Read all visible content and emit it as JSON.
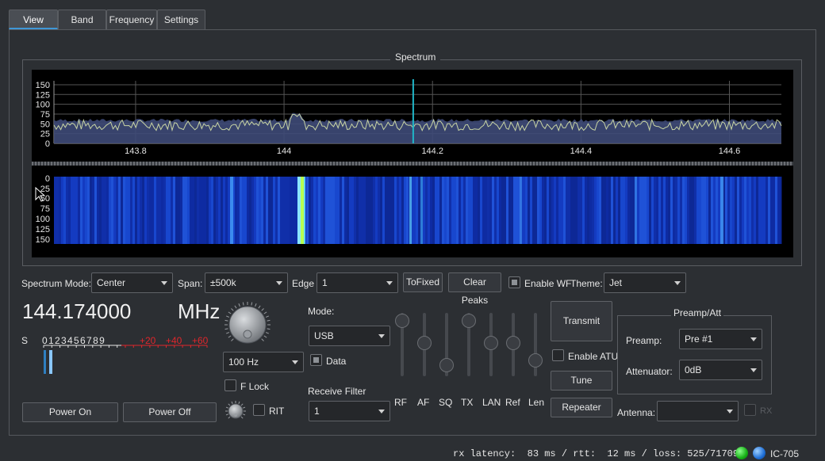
{
  "tabs": [
    {
      "label": "View"
    },
    {
      "label": "Band"
    },
    {
      "label": "Frequency"
    },
    {
      "label": "Settings"
    }
  ],
  "spectrum": {
    "title": "Spectrum",
    "y_ticks": [
      "150",
      "125",
      "100",
      "75",
      "50",
      "25",
      "0"
    ],
    "x_ticks": [
      "143.8",
      "144",
      "144.2",
      "144.4",
      "144.6"
    ],
    "wf_ticks": [
      "0",
      "25",
      "50",
      "75",
      "100",
      "125",
      "150"
    ],
    "colors": {
      "fill": "#3e4a78",
      "line": "#c8d4a4",
      "marker": "#1fb6c8"
    }
  },
  "chart_data": {
    "type": "area",
    "x_range": [
      143.69,
      144.67
    ],
    "ylim": [
      0,
      160
    ],
    "x_ticks": [
      143.8,
      144.0,
      144.2,
      144.4,
      144.6
    ],
    "y_ticks": [
      0,
      25,
      50,
      75,
      100,
      125,
      150
    ],
    "center_marker": 144.174,
    "peaks": [
      {
        "x": 144.013,
        "y": 80
      },
      {
        "x": 144.02,
        "y": 78
      }
    ],
    "baseline": 45
  },
  "controls": {
    "spectrum_mode_label": "Spectrum Mode:",
    "spectrum_mode_value": "Center",
    "span_label": "Span:",
    "span_value": "±500k",
    "edge_label": "Edge",
    "edge_value": "1",
    "tofixed": "ToFixed",
    "clear_peaks": "Clear Peaks",
    "enable_wf": "Enable WF",
    "theme_label": "Theme:",
    "theme_value": "Jet"
  },
  "frequency": {
    "value": "144.174000",
    "unit": "MHz",
    "step_value": "100 Hz",
    "f_lock": "F Lock",
    "rit": "RIT"
  },
  "smeter": {
    "s_label": "S",
    "scale": "0 1 2 3 4 5 6 7 8 9",
    "plus": [
      "+20",
      "+40",
      "+60"
    ]
  },
  "mode": {
    "label": "Mode:",
    "value": "USB",
    "data": "Data",
    "receive_filter_label": "Receive Filter",
    "receive_filter_value": "1"
  },
  "sliders": [
    {
      "label": "RF",
      "level": 1.0
    },
    {
      "label": "AF",
      "level": 0.55
    },
    {
      "label": "SQ",
      "level": 0.1
    },
    {
      "label": "TX",
      "level": 1.0
    },
    {
      "label": "LAN",
      "level": 0.55
    },
    {
      "label": "Ref",
      "level": 0.55
    },
    {
      "label": "Len",
      "level": 0.2
    }
  ],
  "tx": {
    "transmit": "Transmit",
    "enable_atu": "Enable ATU",
    "tune": "Tune",
    "repeater": "Repeater"
  },
  "preamp": {
    "title": "Preamp/Att",
    "preamp_label": "Preamp:",
    "preamp_value": "Pre #1",
    "att_label": "Attenuator:",
    "att_value": "0dB",
    "antenna_label": "Antenna:",
    "antenna_value": "",
    "rx": "RX"
  },
  "power": {
    "on": "Power On",
    "off": "Power Off"
  },
  "status": {
    "text": "rx latency:  83 ms / rtt:  12 ms / loss: 525/71709",
    "radio": "IC-705"
  }
}
